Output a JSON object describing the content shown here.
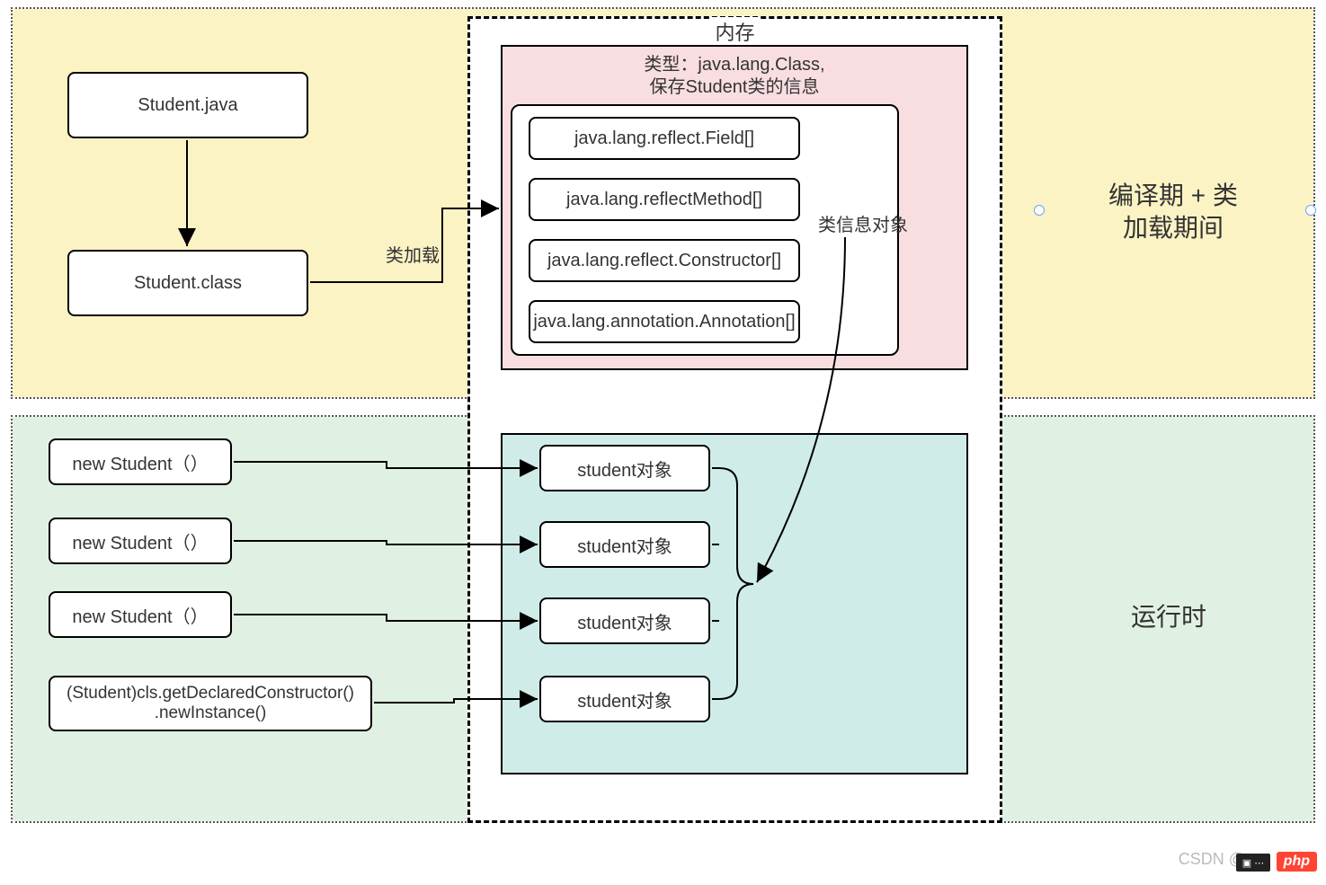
{
  "colors": {
    "yellow": "#fbf3c4",
    "pink": "#f9dee1",
    "teal": "#cfece9",
    "mint": "#e0f1e3"
  },
  "labels": {
    "memory": "内存",
    "class_loading": "类加载",
    "class_type_line1": "类型：java.lang.Class,",
    "class_type_line2": "保存Student类的信息",
    "class_info_obj": "类信息对象",
    "top_right_line1": "编译期 + 类",
    "top_right_line2": "加载期间",
    "runtime": "运行时",
    "watermark": "CSDN @"
  },
  "boxes": {
    "student_java": "Student.java",
    "student_class": "Student.class",
    "field": "java.lang.reflect.Field[]",
    "method": "java.lang.reflectMethod[]",
    "constructor": "java.lang.reflect.Constructor[]",
    "annotation": "java.lang.annotation.Annotation[]",
    "new1": "new Student（）",
    "new2": "new Student（）",
    "new3": "new Student（）",
    "declared_line1": "(Student)cls.getDeclaredConstructor()",
    "declared_line2": ".newInstance()",
    "obj1": "student对象",
    "obj2": "student对象",
    "obj3": "student对象",
    "obj4": "student对象"
  },
  "brand": {
    "php": "php"
  }
}
